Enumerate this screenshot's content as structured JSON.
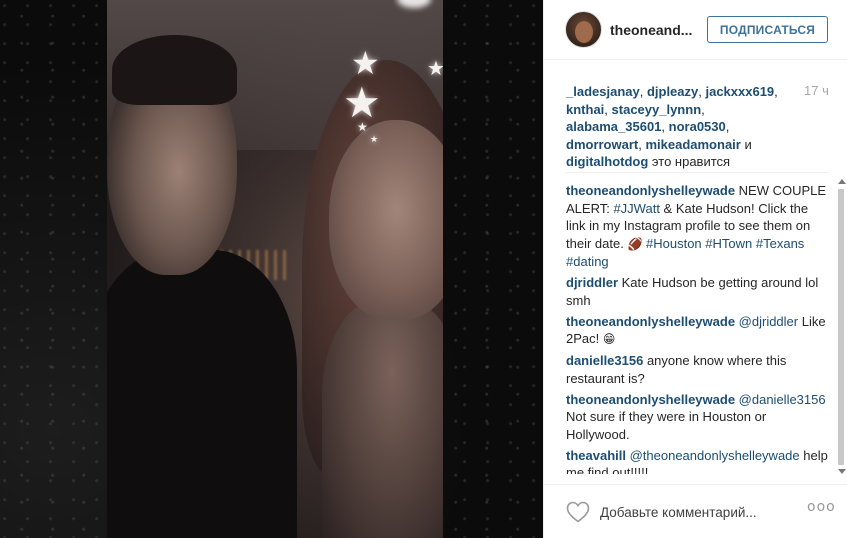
{
  "post": {
    "username": "theoneand...",
    "follow_label": "ПОДПИСАТЬСЯ",
    "time": "17 ч"
  },
  "likes": {
    "users": [
      "_ladesjanay",
      "djpleazy",
      "jackxxx619",
      "knthai",
      "staceyy_lynnn",
      "alabama_35601",
      "nora0530",
      "dmorrowart",
      "mikeadamonair",
      "digitalhotdog"
    ],
    "and_word": "и",
    "suffix": "это нравится"
  },
  "comments": [
    {
      "user": "theoneandonlyshelleywade",
      "parts": [
        {
          "t": "text",
          "v": " NEW COUPLE ALERT: "
        },
        {
          "t": "tag",
          "v": "#JJWatt"
        },
        {
          "t": "text",
          "v": " & Kate Hudson! Click the link in my Instagram profile to see them on their date. "
        },
        {
          "t": "emoji",
          "v": "🏈"
        },
        {
          "t": "text",
          "v": " "
        },
        {
          "t": "tag",
          "v": "#Houston"
        },
        {
          "t": "text",
          "v": " "
        },
        {
          "t": "tag",
          "v": "#HTown"
        },
        {
          "t": "text",
          "v": " "
        },
        {
          "t": "tag",
          "v": "#Texans"
        },
        {
          "t": "text",
          "v": " "
        },
        {
          "t": "tag",
          "v": "#dating"
        }
      ]
    },
    {
      "user": "djriddler",
      "parts": [
        {
          "t": "text",
          "v": " Kate Hudson be getting around lol smh"
        }
      ]
    },
    {
      "user": "theoneandonlyshelleywade",
      "parts": [
        {
          "t": "text",
          "v": " "
        },
        {
          "t": "tag",
          "v": "@djriddler"
        },
        {
          "t": "text",
          "v": " Like 2Pac! "
        },
        {
          "t": "emoji",
          "v": "😁"
        }
      ]
    },
    {
      "user": "danielle3156",
      "parts": [
        {
          "t": "text",
          "v": " anyone know where this restaurant is?"
        }
      ]
    },
    {
      "user": "theoneandonlyshelleywade",
      "parts": [
        {
          "t": "text",
          "v": " "
        },
        {
          "t": "tag",
          "v": "@danielle3156"
        },
        {
          "t": "text",
          "v": " Not sure if they were in Houston or Hollywood."
        }
      ]
    },
    {
      "user": "theavahill",
      "parts": [
        {
          "t": "text",
          "v": " "
        },
        {
          "t": "tag",
          "v": "@theoneandonlyshelleywade"
        },
        {
          "t": "text",
          "v": " help me find out!!!!!"
        }
      ]
    }
  ],
  "footer": {
    "comment_placeholder": "Добавьте комментарий...",
    "more_label": "ooo"
  },
  "icons": {
    "heart": "heart-icon",
    "more": "more-options-icon",
    "avatar": "avatar"
  },
  "colors": {
    "link": "#1d4d72",
    "follow": "#3f729b",
    "time": "#a5a7aa"
  }
}
